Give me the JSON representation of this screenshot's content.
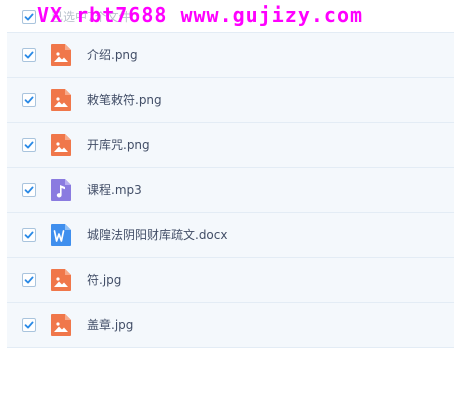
{
  "header": {
    "label": "已选中7个文件",
    "checked": true
  },
  "watermark": {
    "text": "VX rbt7688   www.gujizy.com"
  },
  "files": [
    {
      "name": "介绍.png",
      "icon": "image-icon",
      "checked": true
    },
    {
      "name": "敕笔敕符.png",
      "icon": "image-icon",
      "checked": true
    },
    {
      "name": "开库咒.png",
      "icon": "image-icon",
      "checked": true
    },
    {
      "name": "课程.mp3",
      "icon": "music-icon",
      "checked": true
    },
    {
      "name": "城隍法阴阳财库疏文.docx",
      "icon": "word-icon",
      "checked": true
    },
    {
      "name": "符.jpg",
      "icon": "image-icon",
      "checked": true
    },
    {
      "name": "盖章.jpg",
      "icon": "image-icon",
      "checked": true
    }
  ],
  "colors": {
    "image_icon": "#f0774a",
    "music_icon": "#8a7be0",
    "word_icon": "#3f8fee",
    "check": "#2a8ae6",
    "watermark": "#ff00ff"
  }
}
